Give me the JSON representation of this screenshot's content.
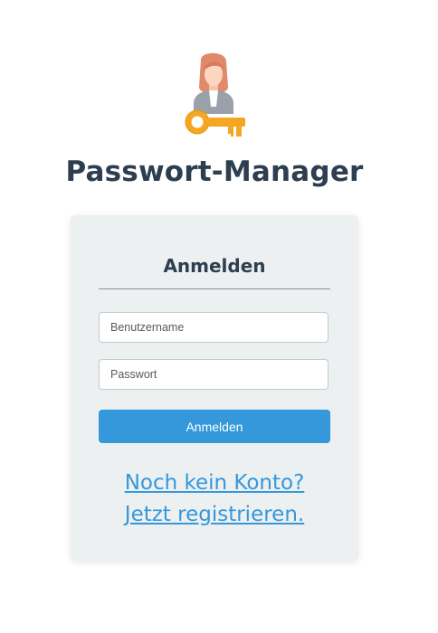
{
  "app": {
    "title": "Passwort-Manager",
    "logo_icon": "user-key-icon"
  },
  "login_form": {
    "heading": "Anmelden",
    "username_placeholder": "Benutzername",
    "password_placeholder": "Passwort",
    "submit_label": "Anmelden"
  },
  "register_link": {
    "line1": "Noch kein Konto?",
    "line2": "Jetzt registrieren."
  },
  "colors": {
    "heading": "#2c3e50",
    "card_background": "#ecf0f1",
    "accent": "#3498db",
    "key": "#f5a623"
  }
}
